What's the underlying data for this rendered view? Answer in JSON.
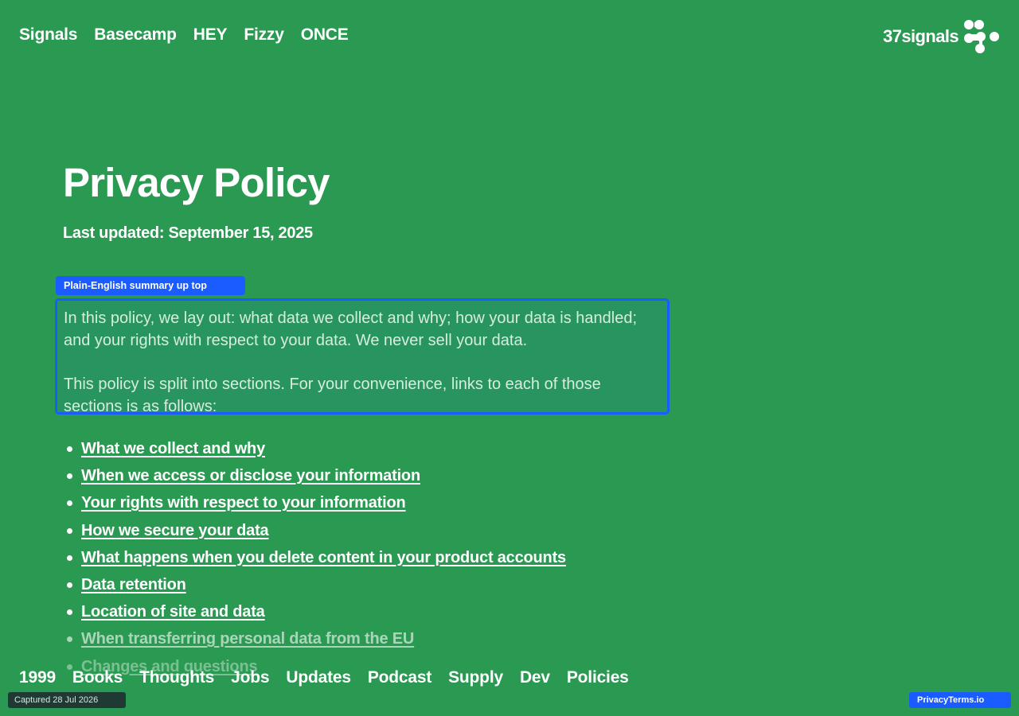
{
  "topnav": {
    "items": [
      "Signals",
      "Basecamp",
      "HEY",
      "Fizzy",
      "ONCE"
    ]
  },
  "brand": {
    "wordmark": "37signals",
    "icon": "37signals-logo-icon"
  },
  "page": {
    "title": "Privacy Policy",
    "last_updated": "Last updated: September 15, 2025"
  },
  "annotation": {
    "label": "Plain-English summary up top",
    "color": "#1a5cff"
  },
  "summary": {
    "paragraph1": "In this policy, we lay out: what data we collect and why; how your data is handled; and your rights with respect to your data. We never sell your data.",
    "paragraph2": "This policy is split into sections. For your convenience, links to each of those sections is as follows:"
  },
  "toc": {
    "items": [
      "What we collect and why",
      "When we access or disclose your information",
      "Your rights with respect to your information",
      "How we secure your data",
      "What happens when you delete content in your product accounts",
      "Data retention",
      "Location of site and data",
      "When transferring personal data from the EU",
      "Changes and questions"
    ]
  },
  "footnav": {
    "items": [
      "1999",
      "Books",
      "Thoughts",
      "Jobs",
      "Updates",
      "Podcast",
      "Supply",
      "Dev",
      "Policies"
    ]
  },
  "capture": {
    "label": "Captured 28 Jul 2026"
  },
  "source_badge": {
    "label": "PrivacyTerms.io"
  },
  "colors": {
    "background": "#2a9952",
    "text": "#ffffff",
    "accent": "#1a5cff"
  }
}
